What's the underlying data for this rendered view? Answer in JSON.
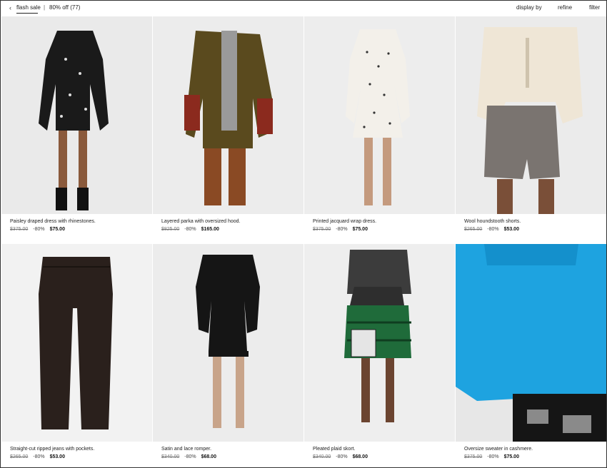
{
  "topbar": {
    "back_icon": "‹",
    "breadcrumb": "flash sale",
    "separator": "|",
    "result_count": "80% off (77)",
    "display_by": "display by",
    "refine": "refine",
    "filter": "filter"
  },
  "products": [
    {
      "name": "Paisley draped dress with rhinestones.",
      "old_price": "$375.00",
      "discount": "-80%",
      "price": "$75.00"
    },
    {
      "name": "Layered parka with oversized hood.",
      "old_price": "$825.00",
      "discount": "-80%",
      "price": "$165.00"
    },
    {
      "name": "Printed jacquard wrap dress.",
      "old_price": "$375.00",
      "discount": "-80%",
      "price": "$75.00"
    },
    {
      "name": "Wool houndstooth shorts.",
      "old_price": "$265.00",
      "discount": "-80%",
      "price": "$53.00"
    },
    {
      "name": "Straight-cut ripped jeans with pockets.",
      "old_price": "$265.00",
      "discount": "-80%",
      "price": "$53.00"
    },
    {
      "name": "Satin and lace romper.",
      "old_price": "$340.00",
      "discount": "-80%",
      "price": "$68.00"
    },
    {
      "name": "Pleated plaid skort.",
      "old_price": "$340.00",
      "discount": "-80%",
      "price": "$68.00"
    },
    {
      "name": "Oversize sweater in cashmere.",
      "old_price": "$375.00",
      "discount": "-80%",
      "price": "$75.00"
    }
  ]
}
